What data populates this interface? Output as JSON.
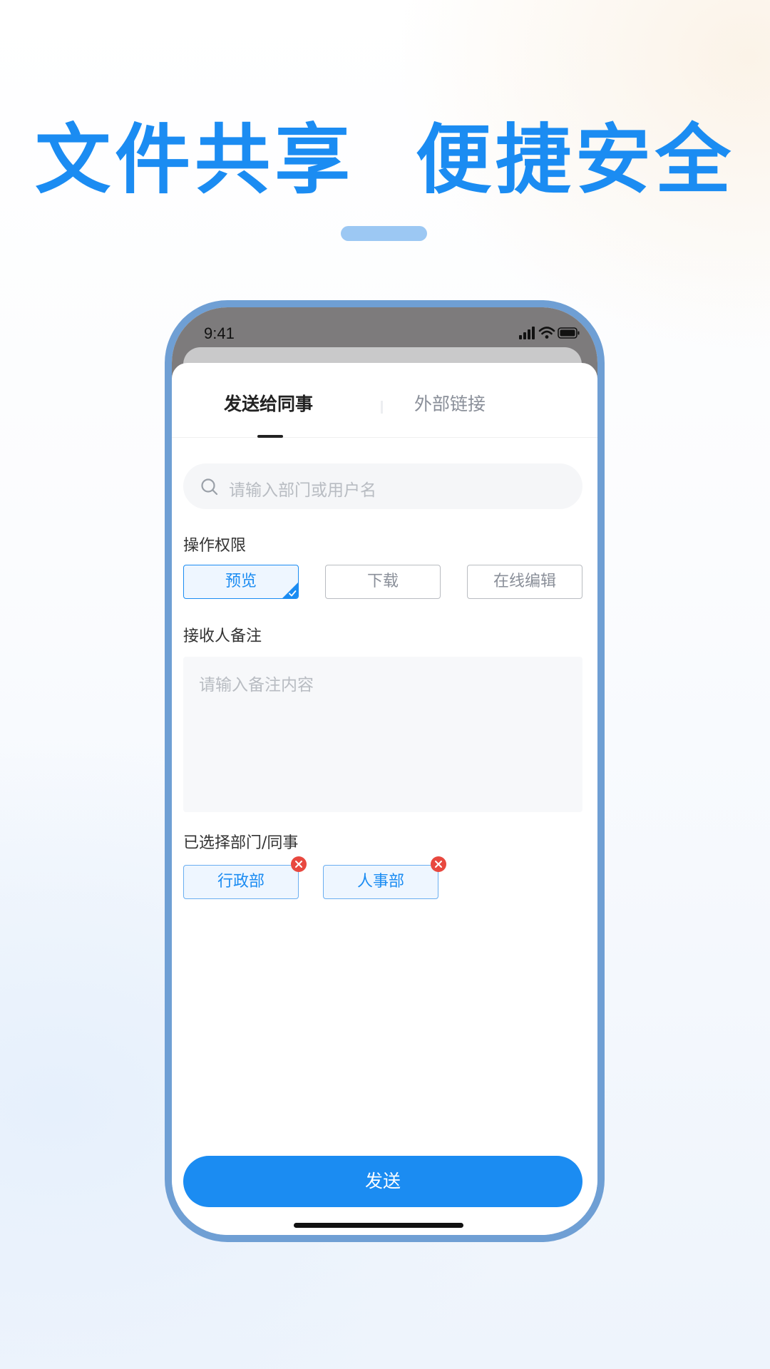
{
  "headline": "文件共享  便捷安全",
  "status_bar": {
    "time": "9:41"
  },
  "tabs": [
    {
      "label": "发送给同事",
      "active": true
    },
    {
      "label": "外部链接",
      "active": false
    }
  ],
  "search": {
    "placeholder": "请输入部门或用户名"
  },
  "permissions": {
    "label": "操作权限",
    "options": [
      {
        "label": "预览",
        "selected": true
      },
      {
        "label": "下载",
        "selected": false
      },
      {
        "label": "在线编辑",
        "selected": false
      }
    ]
  },
  "remark": {
    "label": "接收人备注",
    "placeholder": "请输入备注内容"
  },
  "selected": {
    "label": "已选择部门/同事",
    "items": [
      "行政部",
      "人事部"
    ]
  },
  "send_button": "发送",
  "colors": {
    "accent": "#1b8cf2",
    "phone_frame": "#6f9fd4",
    "remove_badge": "#e8483f"
  }
}
